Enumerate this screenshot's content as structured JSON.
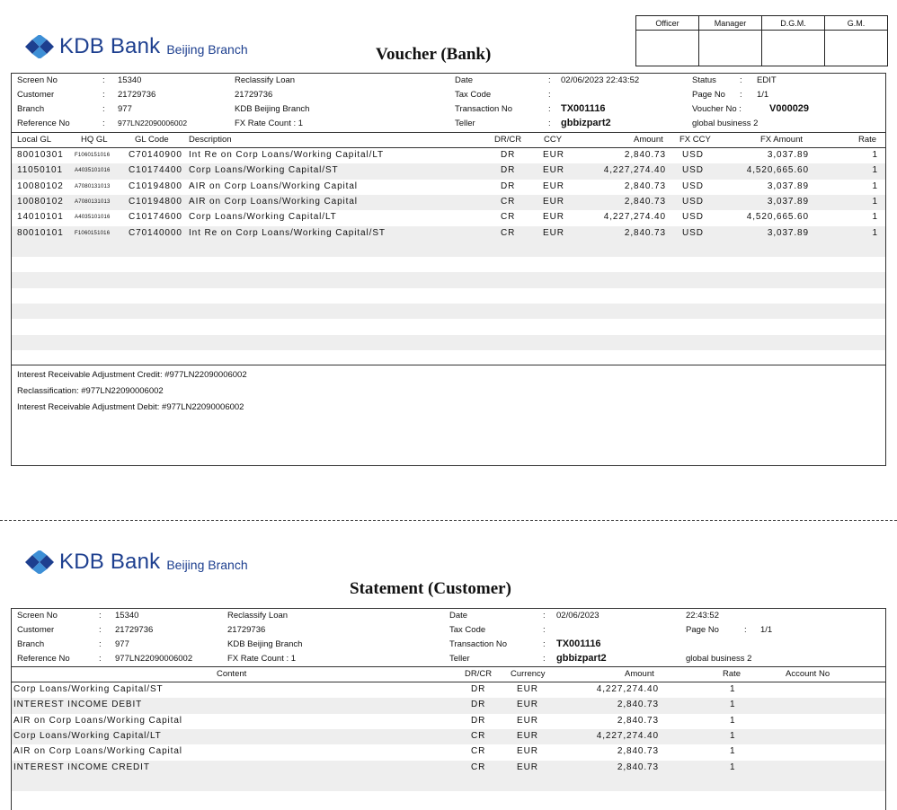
{
  "bank": {
    "name": "KDB Bank",
    "branch": "Beijing Branch"
  },
  "colors": {
    "brand": "#1d3f8f",
    "brand_light": "#3d8fd6",
    "shade": "#eeeeee"
  },
  "signoff": [
    "Officer",
    "Manager",
    "D.G.M.",
    "G.M."
  ],
  "voucher": {
    "title": "Voucher (Bank)",
    "header": {
      "screen_no_label": "Screen No",
      "screen_no": "15340",
      "screen_desc": "Reclassify Loan",
      "customer_label": "Customer",
      "customer": "21729736",
      "customer_name": "21729736",
      "branch_label": "Branch",
      "branch": "977",
      "branch_name": "KDB Beijing Branch",
      "reference_label": "Reference No",
      "reference": "977LN22090006002",
      "fx_count": "FX Rate Count :   1",
      "date_label": "Date",
      "date": "02/06/2023  22:43:52",
      "tax_label": "Tax Code",
      "tax": "",
      "txn_label": "Transaction No",
      "txn": "TX001116",
      "teller_label": "Teller",
      "teller": "gbbizpart2",
      "status_label": "Status",
      "status": "EDIT",
      "page_label": "Page No",
      "page": "1/1",
      "voucher_no_label": "Voucher No :",
      "voucher_no": "V000029",
      "teller_dept": "global business 2",
      "colon": ":"
    },
    "columns": [
      "Local GL",
      "HQ GL",
      "GL Code",
      "Description",
      "DR/CR",
      "CCY",
      "Amount",
      "FX CCY",
      "FX Amount",
      "Rate"
    ],
    "rows": [
      {
        "local_gl": "80010301",
        "hq_gl": "F1060151016",
        "gl_code": "C70140900",
        "desc": "Int Re on Corp Loans/Working Capital/LT",
        "drcr": "DR",
        "ccy": "EUR",
        "amount": "2,840.73",
        "fx_ccy": "USD",
        "fx_amount": "3,037.89",
        "rate": "1"
      },
      {
        "local_gl": "11050101",
        "hq_gl": "A4035101016",
        "gl_code": "C10174400",
        "desc": "Corp Loans/Working Capital/ST",
        "drcr": "DR",
        "ccy": "EUR",
        "amount": "4,227,274.40",
        "fx_ccy": "USD",
        "fx_amount": "4,520,665.60",
        "rate": "1"
      },
      {
        "local_gl": "10080102",
        "hq_gl": "A7080131013",
        "gl_code": "C10194800",
        "desc": "AIR on Corp Loans/Working Capital",
        "drcr": "DR",
        "ccy": "EUR",
        "amount": "2,840.73",
        "fx_ccy": "USD",
        "fx_amount": "3,037.89",
        "rate": "1"
      },
      {
        "local_gl": "10080102",
        "hq_gl": "A7080131013",
        "gl_code": "C10194800",
        "desc": "AIR on Corp Loans/Working Capital",
        "drcr": "CR",
        "ccy": "EUR",
        "amount": "2,840.73",
        "fx_ccy": "USD",
        "fx_amount": "3,037.89",
        "rate": "1"
      },
      {
        "local_gl": "14010101",
        "hq_gl": "A4035101016",
        "gl_code": "C10174600",
        "desc": "Corp Loans/Working Capital/LT",
        "drcr": "CR",
        "ccy": "EUR",
        "amount": "4,227,274.40",
        "fx_ccy": "USD",
        "fx_amount": "4,520,665.60",
        "rate": "1"
      },
      {
        "local_gl": "80010101",
        "hq_gl": "F1060151016",
        "gl_code": "C70140000",
        "desc": "Int Re on Corp Loans/Working Capital/ST",
        "drcr": "CR",
        "ccy": "EUR",
        "amount": "2,840.73",
        "fx_ccy": "USD",
        "fx_amount": "3,037.89",
        "rate": "1"
      }
    ],
    "memo": [
      "Interest Receivable Adjustment Credit: #977LN22090006002",
      "Reclassification: #977LN22090006002",
      "Interest Receivable Adjustment Debit: #977LN22090006002"
    ]
  },
  "statement": {
    "title": "Statement (Customer)",
    "header": {
      "screen_no_label": "Screen No",
      "screen_no": "15340",
      "screen_desc": "Reclassify Loan",
      "customer_label": "Customer",
      "customer": "21729736",
      "customer_name": "21729736",
      "branch_label": "Branch",
      "branch": "977",
      "branch_name": "KDB Beijing Branch",
      "reference_label": "Reference No",
      "reference": "977LN22090006002",
      "fx_count": "FX Rate Count :   1",
      "date_label": "Date",
      "date": "02/06/2023",
      "time": "22:43:52",
      "tax_label": "Tax Code",
      "txn_label": "Transaction No",
      "txn": "TX001116",
      "teller_label": "Teller",
      "teller": "gbbizpart2",
      "page_label": "Page No",
      "page": "1/1",
      "teller_dept": "global business 2",
      "colon": ":"
    },
    "columns": [
      "Content",
      "DR/CR",
      "Currency",
      "Amount",
      "Rate",
      "Account No"
    ],
    "rows": [
      {
        "content": "Corp Loans/Working Capital/ST",
        "drcr": "DR",
        "ccy": "EUR",
        "amount": "4,227,274.40",
        "rate": "1"
      },
      {
        "content": "INTEREST INCOME DEBIT",
        "drcr": "DR",
        "ccy": "EUR",
        "amount": "2,840.73",
        "rate": "1"
      },
      {
        "content": "AIR on Corp Loans/Working Capital",
        "drcr": "DR",
        "ccy": "EUR",
        "amount": "2,840.73",
        "rate": "1"
      },
      {
        "content": "Corp Loans/Working Capital/LT",
        "drcr": "CR",
        "ccy": "EUR",
        "amount": "4,227,274.40",
        "rate": "1"
      },
      {
        "content": "AIR on Corp Loans/Working Capital",
        "drcr": "CR",
        "ccy": "EUR",
        "amount": "2,840.73",
        "rate": "1"
      },
      {
        "content": "INTEREST INCOME CREDIT",
        "drcr": "CR",
        "ccy": "EUR",
        "amount": "2,840.73",
        "rate": "1"
      }
    ]
  }
}
